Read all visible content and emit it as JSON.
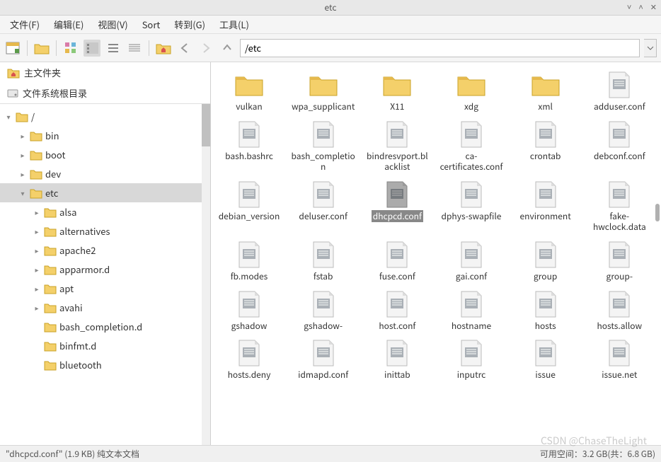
{
  "window": {
    "title": "etc"
  },
  "menu": {
    "file": "文件(F)",
    "edit": "编辑(E)",
    "view": "视图(V)",
    "sort": "Sort",
    "goto": "转到(G)",
    "tools": "工具(L)"
  },
  "toolbar": {
    "path": "/etc"
  },
  "places": {
    "home": "主文件夹",
    "root": "文件系统根目录"
  },
  "tree": [
    {
      "name": "/",
      "depth": 0,
      "exp": "down",
      "sel": false
    },
    {
      "name": "bin",
      "depth": 1,
      "exp": "right",
      "sel": false
    },
    {
      "name": "boot",
      "depth": 1,
      "exp": "right",
      "sel": false
    },
    {
      "name": "dev",
      "depth": 1,
      "exp": "right",
      "sel": false
    },
    {
      "name": "etc",
      "depth": 1,
      "exp": "down",
      "sel": true
    },
    {
      "name": "alsa",
      "depth": 2,
      "exp": "right",
      "sel": false
    },
    {
      "name": "alternatives",
      "depth": 2,
      "exp": "right",
      "sel": false
    },
    {
      "name": "apache2",
      "depth": 2,
      "exp": "right",
      "sel": false
    },
    {
      "name": "apparmor.d",
      "depth": 2,
      "exp": "right",
      "sel": false
    },
    {
      "name": "apt",
      "depth": 2,
      "exp": "right",
      "sel": false
    },
    {
      "name": "avahi",
      "depth": 2,
      "exp": "right",
      "sel": false
    },
    {
      "name": "bash_completion.d",
      "depth": 2,
      "exp": "none",
      "sel": false
    },
    {
      "name": "binfmt.d",
      "depth": 2,
      "exp": "none",
      "sel": false
    },
    {
      "name": "bluetooth",
      "depth": 2,
      "exp": "none",
      "sel": false
    }
  ],
  "files": [
    {
      "name": "vulkan",
      "type": "folder",
      "sel": false
    },
    {
      "name": "wpa_supplicant",
      "type": "folder",
      "sel": false
    },
    {
      "name": "X11",
      "type": "folder",
      "sel": false
    },
    {
      "name": "xdg",
      "type": "folder",
      "sel": false
    },
    {
      "name": "xml",
      "type": "folder",
      "sel": false
    },
    {
      "name": "adduser.conf",
      "type": "file",
      "sel": false
    },
    {
      "name": "bash.bashrc",
      "type": "file",
      "sel": false
    },
    {
      "name": "bash_completion",
      "type": "file",
      "sel": false
    },
    {
      "name": "bindresvport.blacklist",
      "type": "file",
      "sel": false
    },
    {
      "name": "ca-certificates.conf",
      "type": "file",
      "sel": false
    },
    {
      "name": "crontab",
      "type": "file",
      "sel": false
    },
    {
      "name": "debconf.conf",
      "type": "file",
      "sel": false
    },
    {
      "name": "debian_version",
      "type": "file",
      "sel": false
    },
    {
      "name": "deluser.conf",
      "type": "file",
      "sel": false
    },
    {
      "name": "dhcpcd.conf",
      "type": "file",
      "sel": true
    },
    {
      "name": "dphys-swapfile",
      "type": "file",
      "sel": false
    },
    {
      "name": "environment",
      "type": "file",
      "sel": false
    },
    {
      "name": "fake-hwclock.data",
      "type": "file",
      "sel": false
    },
    {
      "name": "fb.modes",
      "type": "file",
      "sel": false
    },
    {
      "name": "fstab",
      "type": "file",
      "sel": false
    },
    {
      "name": "fuse.conf",
      "type": "file",
      "sel": false
    },
    {
      "name": "gai.conf",
      "type": "file",
      "sel": false
    },
    {
      "name": "group",
      "type": "file",
      "sel": false
    },
    {
      "name": "group-",
      "type": "file",
      "sel": false
    },
    {
      "name": "gshadow",
      "type": "file",
      "sel": false
    },
    {
      "name": "gshadow-",
      "type": "file",
      "sel": false
    },
    {
      "name": "host.conf",
      "type": "file",
      "sel": false
    },
    {
      "name": "hostname",
      "type": "file",
      "sel": false
    },
    {
      "name": "hosts",
      "type": "file",
      "sel": false
    },
    {
      "name": "hosts.allow",
      "type": "file",
      "sel": false
    },
    {
      "name": "hosts.deny",
      "type": "file",
      "sel": false
    },
    {
      "name": "idmapd.conf",
      "type": "file",
      "sel": false
    },
    {
      "name": "inittab",
      "type": "file",
      "sel": false
    },
    {
      "name": "inputrc",
      "type": "file",
      "sel": false
    },
    {
      "name": "issue",
      "type": "file",
      "sel": false
    },
    {
      "name": "issue.net",
      "type": "file",
      "sel": false
    }
  ],
  "status": {
    "left": "\"dhcpcd.conf\" (1.9 KB) 纯文本文档",
    "right": "可用空间：3.2 GB(共：6.8 GB)"
  },
  "watermark": "CSDN @ChaseTheLight"
}
